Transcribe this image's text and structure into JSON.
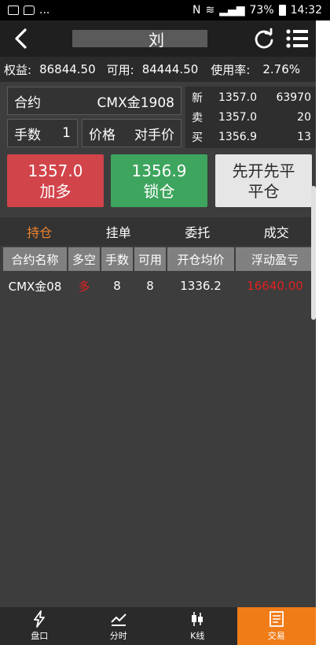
{
  "statusbar": {
    "left_text": "...",
    "battery": "73%",
    "time": "14:32"
  },
  "title": {
    "text": "刘"
  },
  "account": {
    "equity_label": "权益:",
    "equity_value": "86844.50",
    "available_label": "可用:",
    "available_value": "84444.50",
    "usage_label": "使用率:",
    "usage_value": "2.76%"
  },
  "form": {
    "contract_label": "合约",
    "contract_value": "CMX金1908",
    "qty_label": "手数",
    "qty_value": "1",
    "price_label": "价格",
    "price_value": "对手价"
  },
  "quote": {
    "rows": [
      {
        "key": "新",
        "price": "1357.0",
        "volume": "63970"
      },
      {
        "key": "卖",
        "price": "1357.0",
        "volume": "20"
      },
      {
        "key": "买",
        "price": "1356.9",
        "volume": "13"
      }
    ]
  },
  "actions": {
    "buy_price": "1357.0",
    "buy_label": "加多",
    "lock_price": "1356.9",
    "lock_label": "锁仓",
    "close_line1": "先开先平",
    "close_line2": "平仓"
  },
  "tabs": [
    "持仓",
    "挂单",
    "委托",
    "成交"
  ],
  "table": {
    "headers": [
      "合约名称",
      "多空",
      "手数",
      "可用",
      "开仓均价",
      "浮动盈亏"
    ],
    "rows": [
      [
        "CMX金08",
        "多",
        "8",
        "8",
        "1336.2",
        "16640.00"
      ]
    ]
  },
  "bottomnav": [
    {
      "label": "盘口",
      "icon": "lightning-icon"
    },
    {
      "label": "分时",
      "icon": "line-chart-icon"
    },
    {
      "label": "K线",
      "icon": "candlestick-icon"
    },
    {
      "label": "交易",
      "icon": "document-icon"
    }
  ],
  "colors": {
    "accent": "#f07c18",
    "buy": "#d1444a",
    "lock": "#3ea55e",
    "loss_profit": "#e02020"
  }
}
